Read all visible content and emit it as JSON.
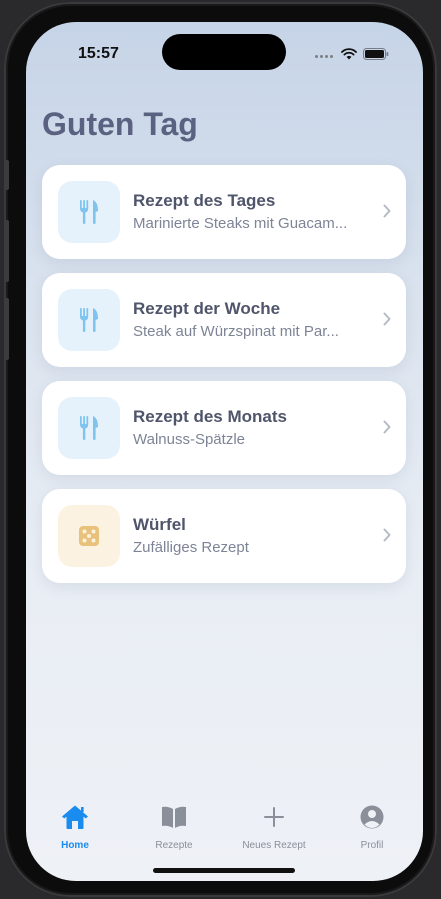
{
  "status_bar": {
    "time": "15:57"
  },
  "page": {
    "greeting": "Guten Tag"
  },
  "cards": [
    {
      "title": "Rezept des Tages",
      "subtitle": "Marinierte Steaks mit Guacam...",
      "icon": "fork-knife-icon",
      "icon_color": "#7fc4ee"
    },
    {
      "title": "Rezept der Woche",
      "subtitle": "Steak auf Würzspinat mit Par...",
      "icon": "fork-knife-icon",
      "icon_color": "#7fc4ee"
    },
    {
      "title": "Rezept des Monats",
      "subtitle": "Walnuss-Spätzle",
      "icon": "fork-knife-icon",
      "icon_color": "#7fc4ee"
    },
    {
      "title": "Würfel",
      "subtitle": "Zufälliges Rezept",
      "icon": "dice-icon",
      "icon_color": "#e8c27a"
    }
  ],
  "tabbar": {
    "items": [
      {
        "label": "Home",
        "icon": "house-icon",
        "active": true
      },
      {
        "label": "Rezepte",
        "icon": "book-icon",
        "active": false
      },
      {
        "label": "Neues Rezept",
        "icon": "plus-icon",
        "active": false
      },
      {
        "label": "Profil",
        "icon": "person-circle-icon",
        "active": false
      }
    ]
  },
  "colors": {
    "accent": "#1a8cf0",
    "heading": "#5b6180",
    "tab_inactive": "#8a8f99"
  }
}
